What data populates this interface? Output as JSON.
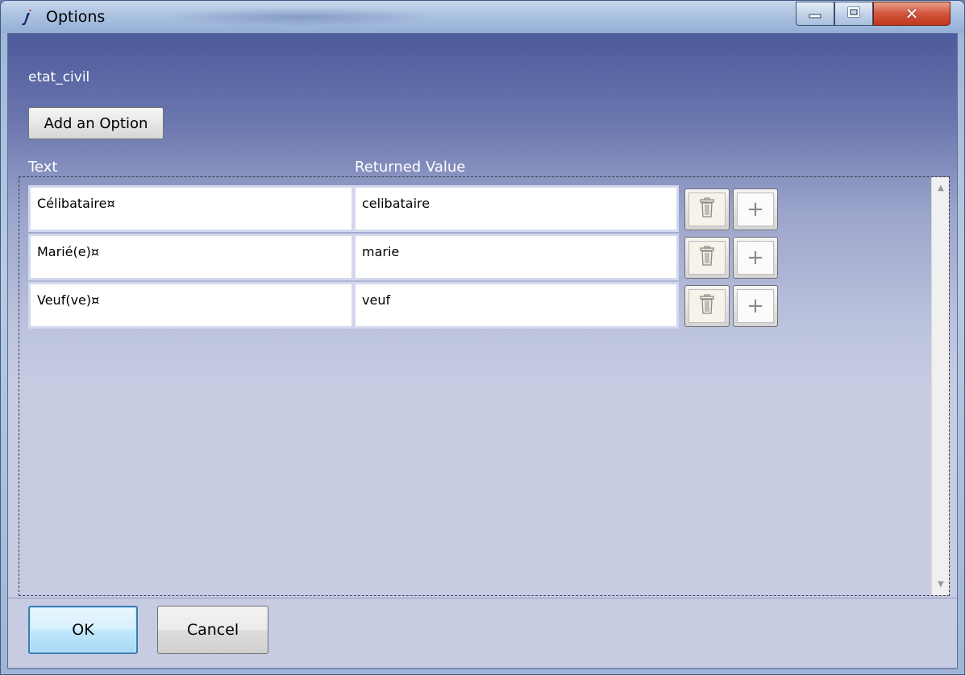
{
  "window": {
    "title": "Options"
  },
  "field": {
    "name": "etat_civil"
  },
  "toolbar": {
    "add_label": "Add an Option"
  },
  "columns": {
    "text": "Text",
    "returned_value": "Returned Value"
  },
  "rows": [
    {
      "text": "Célibataire¤",
      "value": "celibataire"
    },
    {
      "text": "Marié(e)¤",
      "value": "marie"
    },
    {
      "text": "Veuf(ve)¤",
      "value": "veuf"
    }
  ],
  "footer": {
    "ok_label": "OK",
    "cancel_label": "Cancel"
  },
  "icons": {
    "app": "app-icon",
    "minimize": "minimize-icon",
    "maximize": "maximize-icon",
    "close": "close-icon",
    "delete": "trash-icon",
    "add": "plus-icon"
  },
  "colors": {
    "close_button": "#c1371e",
    "header_gradient_top": "#4d5a9c",
    "ok_border": "#3c7fb1"
  }
}
